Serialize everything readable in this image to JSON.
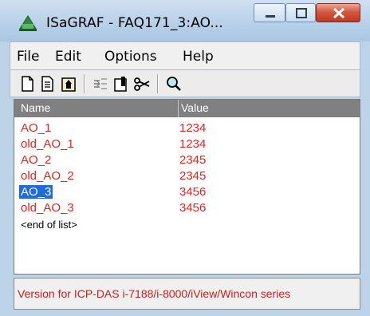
{
  "window": {
    "title": "ISaGRAF - FAQ171_3:AO..."
  },
  "menu": [
    {
      "label": "File"
    },
    {
      "label": "Edit"
    },
    {
      "label": "Options"
    },
    {
      "label": "Help"
    }
  ],
  "toolbar": {
    "icons": [
      "new-icon",
      "copy-icon",
      "paste-icon",
      "move-icon",
      "edit-icon",
      "cut-icon",
      "search-icon"
    ]
  },
  "list": {
    "columns": [
      "Name",
      "Value"
    ],
    "rows": [
      {
        "name": "AO_1",
        "value": "1234"
      },
      {
        "name": "old_AO_1",
        "value": "1234"
      },
      {
        "name": "AO_2",
        "value": "2345"
      },
      {
        "name": "old_AO_2",
        "value": "2345"
      },
      {
        "name": "AO_3",
        "value": "3456",
        "selected": true
      },
      {
        "name": "old_AO_3",
        "value": "3456"
      }
    ],
    "end_text": "<end of list>"
  },
  "status": {
    "text": "Version for ICP-DAS i-7188/i-8000/iView/Wincon series"
  },
  "colors": {
    "value_text": "#e8231f",
    "selection": "#1e6ae0",
    "header_bg": "#808080",
    "status_text": "#cc1f1a"
  }
}
